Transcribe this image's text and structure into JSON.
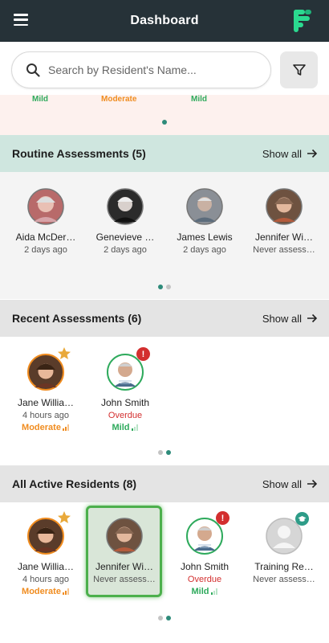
{
  "header": {
    "title": "Dashboard"
  },
  "search": {
    "placeholder": "Search by Resident's Name..."
  },
  "alert_strip": {
    "partial_labels": [
      "Mild",
      "Moderate",
      "Mild"
    ]
  },
  "routine": {
    "title": "Routine Assessments (5)",
    "show_all": "Show all",
    "items": [
      {
        "name": "Aida McDer…",
        "sub": "2 days ago"
      },
      {
        "name": "Genevieve …",
        "sub": "2 days ago"
      },
      {
        "name": "James Lewis",
        "sub": "2 days ago"
      },
      {
        "name": "Jennifer Wi…",
        "sub": "Never assess…"
      }
    ]
  },
  "recent": {
    "title": "Recent Assessments (6)",
    "show_all": "Show all",
    "items": [
      {
        "name": "Jane Willia…",
        "sub": "4 hours ago",
        "severity": "Moderate"
      },
      {
        "name": "John Smith",
        "status": "Overdue",
        "severity": "Mild"
      }
    ]
  },
  "active": {
    "title": "All Active Residents (8)",
    "show_all": "Show all",
    "items": [
      {
        "name": "Jane Willia…",
        "sub": "4 hours ago",
        "severity": "Moderate"
      },
      {
        "name": "Jennifer Wi…",
        "sub": "Never assess…"
      },
      {
        "name": "John Smith",
        "status": "Overdue",
        "severity": "Mild"
      },
      {
        "name": "Training Re…",
        "sub": "Never assess…"
      }
    ]
  },
  "alert_badge": "!",
  "colors": {
    "topbar": "#263238",
    "accent_green": "#2e9c88",
    "moderate": "#f08c1f",
    "mild": "#2eaa5c",
    "overdue": "#d32f2f",
    "routine_header": "#cfe6df",
    "gray_header": "#e4e4e4"
  },
  "icons": [
    "menu-icon",
    "brand-logo",
    "search-icon",
    "filter-icon",
    "arrow-right-icon",
    "star-icon",
    "alert-icon",
    "graduation-cap-icon",
    "signal-bars-icon"
  ]
}
